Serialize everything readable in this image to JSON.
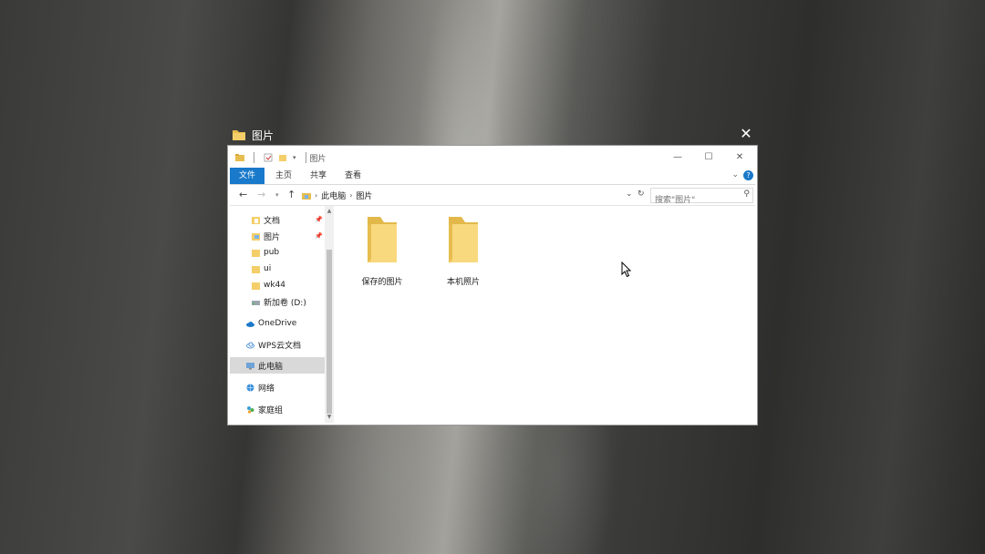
{
  "taskview": {
    "caption": "图片",
    "close_glyph": "✕"
  },
  "window": {
    "title": "图片",
    "controls": {
      "minimize": "—",
      "maximize": "☐",
      "close": "✕"
    }
  },
  "ribbon": {
    "tabs": [
      {
        "label": "文件",
        "active": true
      },
      {
        "label": "主页"
      },
      {
        "label": "共享"
      },
      {
        "label": "查看"
      }
    ],
    "help": "?"
  },
  "address": {
    "segments": [
      "此电脑",
      "图片"
    ],
    "search_placeholder": "搜索\"图片\""
  },
  "nav_pane": {
    "items": [
      {
        "label": "文档",
        "pinned": true
      },
      {
        "label": "图片",
        "pinned": true
      },
      {
        "label": "pub"
      },
      {
        "label": "ui"
      },
      {
        "label": "wk44"
      },
      {
        "label": "新加卷 (D:)"
      },
      {
        "label": "OneDrive"
      },
      {
        "label": "WPS云文档"
      },
      {
        "label": "此电脑",
        "selected": true
      },
      {
        "label": "网络"
      },
      {
        "label": "家庭组"
      }
    ]
  },
  "content": {
    "items": [
      {
        "label": "保存的图片"
      },
      {
        "label": "本机照片"
      }
    ]
  },
  "colors": {
    "accent": "#1979ca",
    "folder": "#f4ce68",
    "selection": "#d9d9d9"
  }
}
